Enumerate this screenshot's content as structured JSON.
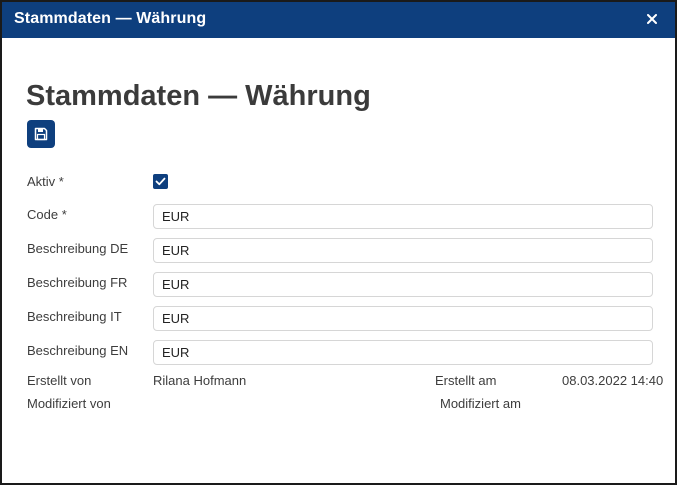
{
  "window": {
    "title": "Stammdaten — Währung",
    "close_icon": "close-icon"
  },
  "page": {
    "heading": "Stammdaten — Währung",
    "save_icon": "floppy-disk-icon"
  },
  "form": {
    "aktiv": {
      "label": "Aktiv *",
      "checked": true
    },
    "code": {
      "label": "Code *",
      "value": "EUR"
    },
    "beschreibung_de": {
      "label": "Beschreibung DE",
      "value": "EUR"
    },
    "beschreibung_fr": {
      "label": "Beschreibung FR",
      "value": "EUR"
    },
    "beschreibung_it": {
      "label": "Beschreibung IT",
      "value": "EUR"
    },
    "beschreibung_en": {
      "label": "Beschreibung EN",
      "value": "EUR"
    }
  },
  "meta": {
    "erstellt_von_label": "Erstellt von",
    "erstellt_von_value": "Rilana Hofmann",
    "erstellt_am_label": "Erstellt am",
    "erstellt_am_value": "08.03.2022 14:40",
    "modifiziert_von_label": "Modifiziert von",
    "modifiziert_am_label": "Modifiziert am"
  },
  "colors": {
    "accent": "#0e3f7e",
    "text": "#3d3d3d",
    "border": "#d6d6d6"
  }
}
